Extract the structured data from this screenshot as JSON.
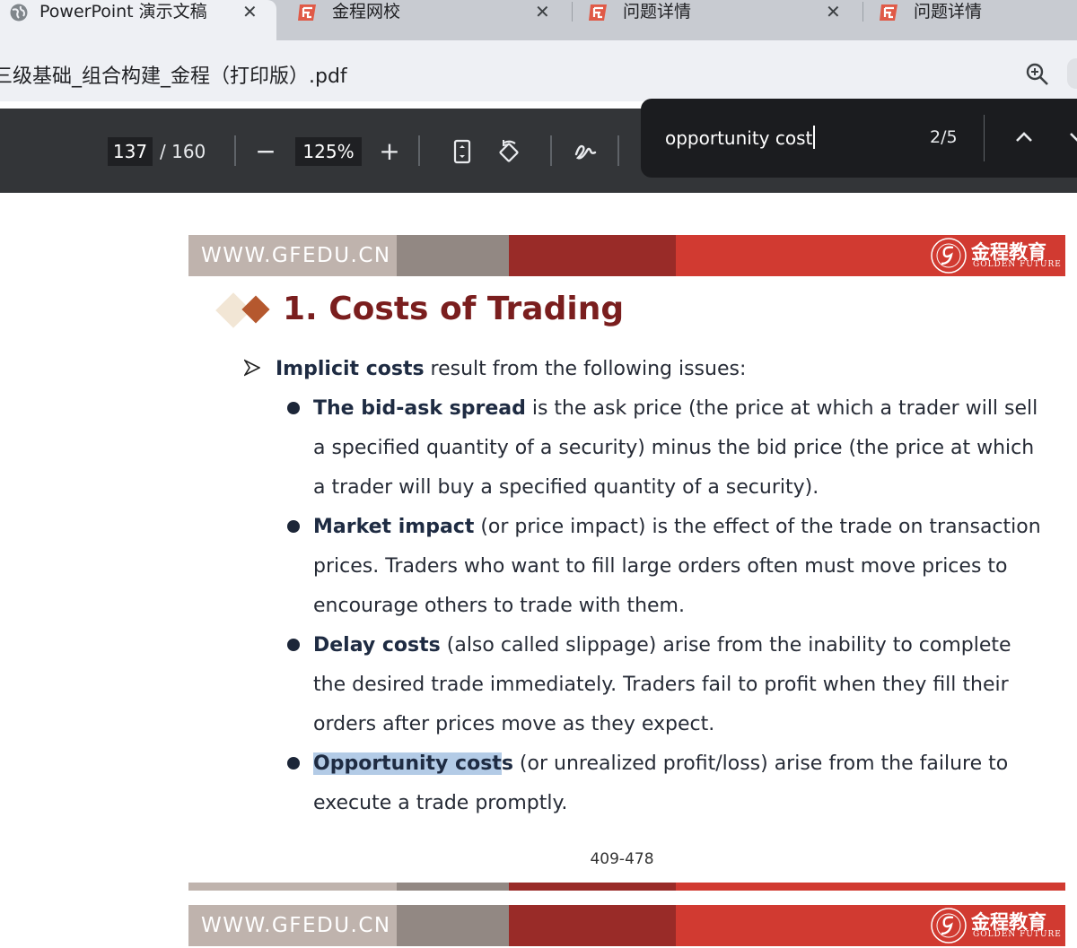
{
  "browser": {
    "tabs": [
      {
        "label": "PowerPoint 演示文稿",
        "active": true,
        "icon": "globe-icon"
      },
      {
        "label": "金程网校",
        "active": false,
        "icon": "gf-favicon"
      },
      {
        "label": "问题详情",
        "active": false,
        "icon": "gf-favicon"
      },
      {
        "label": "问题详情",
        "active": false,
        "icon": "gf-favicon"
      }
    ],
    "close_glyph": "✕",
    "address": "三级基础_组合构建_金程（打印版）.pdf"
  },
  "pdf_toolbar": {
    "current_page": "137",
    "total_pages": "/ 160",
    "zoom": "125%",
    "zoom_out": "−",
    "zoom_in": "+"
  },
  "find_bar": {
    "query": "opportunity cost",
    "count": "2/5"
  },
  "slide": {
    "banner_url": "WWW.GFEDU.CN",
    "logo_cn": "金程教育",
    "logo_en": "GOLDEN FUTURE",
    "title": "1. Costs of Trading",
    "intro_bold": "Implicit costs",
    "intro_rest": " result from the following issues:",
    "bullets": [
      {
        "bold": "The bid-ask spread",
        "lines": [
          " is the ask price (the price at which a trader will sell",
          "a specified quantity of a security) minus the bid price (the price at which",
          "a trader will buy a specified quantity of a security)."
        ]
      },
      {
        "bold": "Market impact",
        "lines": [
          " (or price impact) is the effect of the trade on transaction",
          "prices. Traders who want to fill large orders often must move prices to",
          "encourage others to trade with them."
        ]
      },
      {
        "bold": "Delay costs",
        "lines": [
          " (also called slippage) arise from the inability to complete",
          "the desired trade immediately. Traders fail to profit when they fill their",
          "orders after prices move as they expect."
        ]
      },
      {
        "bold_highlight": "Opportunity cost",
        "bold_rest": "s",
        "lines": [
          " (or unrealized profit/loss) arise from the failure to",
          "execute a trade promptly."
        ]
      }
    ],
    "page_number": "409-478"
  },
  "colors": {
    "banner_gray1": "#bfb3ad",
    "banner_gray2": "#928883",
    "banner_dark_red": "#992b28",
    "banner_red": "#d13a31",
    "title_color": "#7a1e1e",
    "highlight": "#b3cbe6"
  }
}
